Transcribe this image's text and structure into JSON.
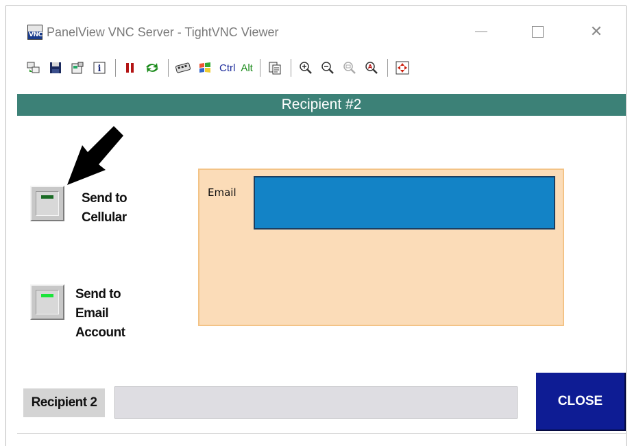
{
  "window": {
    "title": "PanelView VNC Server - TightVNC Viewer",
    "icon_text": "VNC"
  },
  "toolbar": {
    "items": [
      {
        "icon": "new-connection-icon"
      },
      {
        "icon": "save-icon"
      },
      {
        "icon": "options-icon"
      },
      {
        "icon": "info-icon"
      },
      {
        "icon": "pause-icon"
      },
      {
        "icon": "refresh-icon"
      },
      {
        "icon": "ctrl-alt-del-icon"
      },
      {
        "icon": "windows-key-icon"
      },
      {
        "label": "Ctrl"
      },
      {
        "label": "Alt"
      },
      {
        "icon": "clipboard-icon"
      },
      {
        "icon": "zoom-in-icon"
      },
      {
        "icon": "zoom-out-icon"
      },
      {
        "icon": "zoom-100-icon"
      },
      {
        "icon": "zoom-auto-icon"
      },
      {
        "icon": "fullscreen-icon"
      }
    ],
    "ctrl_label": "Ctrl",
    "alt_label": "Alt"
  },
  "screen": {
    "header": "Recipient #2",
    "send_cellular": {
      "line1": "Send to",
      "line2": "Cellular",
      "led_color": "#1a6b25"
    },
    "send_email": {
      "line1": "Send to",
      "line2": "Email",
      "line3": "Account",
      "led_color": "#1be43a"
    },
    "email": {
      "label": "Email",
      "value": ""
    },
    "recipient": {
      "label": "Recipient 2",
      "value": ""
    },
    "close_label": "CLOSE"
  },
  "colors": {
    "header_bg": "#3c8177",
    "email_panel_bg": "#fbdcb8",
    "email_field_bg": "#1383c6",
    "close_bg": "#0e1c94"
  }
}
